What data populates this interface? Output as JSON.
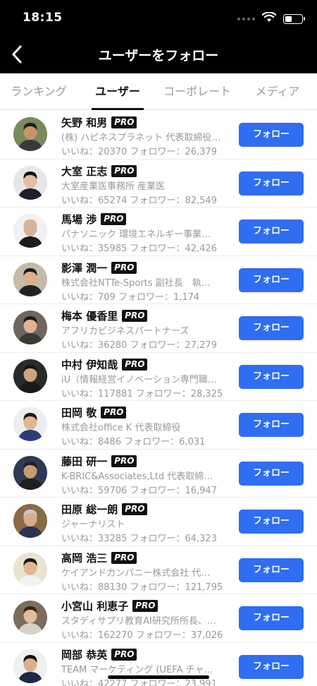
{
  "status_bar": {
    "time": "18:15"
  },
  "nav": {
    "title": "ユーザーをフォロー"
  },
  "tabs": [
    {
      "label": "ランキング"
    },
    {
      "label": "ユーザー"
    },
    {
      "label": "コーポレート"
    },
    {
      "label": "メディア"
    }
  ],
  "badge_label": "PRO",
  "follow_label": "フォロー",
  "users": [
    {
      "name": "矢野 和男",
      "subtitle": "(株) ハピネスプラネット 代表取締役…",
      "stats": "いいね：20370 フォロワー：26,379",
      "skin": "#c9946b",
      "hair": "#1e1a16",
      "bg": "#7a8a5c",
      "shirt": "#3a3a3a"
    },
    {
      "name": "大室 正志",
      "subtitle": "大室産業医事務所 産業医",
      "stats": "いいね：65274 フォロワー：82,549",
      "skin": "#e2bf9d",
      "hair": "#111111",
      "bg": "#e7e7e7",
      "shirt": "#1b1f2a"
    },
    {
      "name": "馬場 渉",
      "subtitle": "パナソニック 環境エネルギー事業…",
      "stats": "いいね：35985 フォロワー：42,426",
      "skin": "#d6b497",
      "hair": "#d6b497",
      "bg": "#f1f1f1",
      "shirt": "#1c1c1c"
    },
    {
      "name": "影澤 潤一",
      "subtitle": "株式会社NTTe-Sports 副社長　執…",
      "stats": "いいね：709 フォロワー：1,174",
      "skin": "#d9b08c",
      "hair": "#1c1a18",
      "bg": "#c6b9a8",
      "shirt": "#222222"
    },
    {
      "name": "梅本 優香里",
      "subtitle": "アフリカビジネスパートナーズ",
      "stats": "いいね：36280 フォロワー：27,279",
      "skin": "#dcb595",
      "hair": "#241a14",
      "bg": "#6e6760",
      "shirt": "#3d3a36"
    },
    {
      "name": "中村 伊知哉",
      "subtitle": "iU（情報経営イノベーション専門職…",
      "stats": "いいね：117881 フォロワー：28,325",
      "skin": "#cfa57f",
      "hair": "#161616",
      "bg": "#2a2a2a",
      "shirt": "#1a1a1a"
    },
    {
      "name": "田岡 敬",
      "subtitle": "株式会社office K 代表取締役",
      "stats": "いいね：8486 フォロワー：6,031",
      "skin": "#e1b58f",
      "hair": "#1b1b1b",
      "bg": "#eeeeee",
      "shirt": "#2c3e78"
    },
    {
      "name": "藤田 研一",
      "subtitle": "K-BRIC&Associates,Ltd 代表取締…",
      "stats": "いいね：59706 フォロワー：16,947",
      "skin": "#c99b75",
      "hair": "#222222",
      "bg": "#2c3a52",
      "shirt": "#1f1f1f"
    },
    {
      "name": "田原 総一朗",
      "subtitle": "ジャーナリスト",
      "stats": "いいね：33285 フォロワー：64,323",
      "skin": "#d8ad88",
      "hair": "#c9c9c9",
      "bg": "#8a6a45",
      "shirt": "#2a3550"
    },
    {
      "name": "高岡 浩三",
      "subtitle": "ケイアンドカンパニー株式会社 代…",
      "stats": "いいね：88130 フォロワー：121,795",
      "skin": "#e0b693",
      "hair": "#1a1a1a",
      "bg": "#e9e3d0",
      "shirt": "#f2f2f2"
    },
    {
      "name": "小宮山 利恵子",
      "subtitle": "スタディサプリ教育AI研究所所長、…",
      "stats": "いいね：162270 フォロワー：37,026",
      "skin": "#e2bd9c",
      "hair": "#3a2418",
      "bg": "#7b6c5c",
      "shirt": "#d9d3c5"
    },
    {
      "name": "岡部 恭英",
      "subtitle": "TEAM マーケティング (UEFA チャ…",
      "stats": "いいね：42277 フォロワー：23,991",
      "skin": "#dbb08a",
      "hair": "#121212",
      "bg": "#f0f0f0",
      "shirt": "#1e2a44"
    }
  ]
}
